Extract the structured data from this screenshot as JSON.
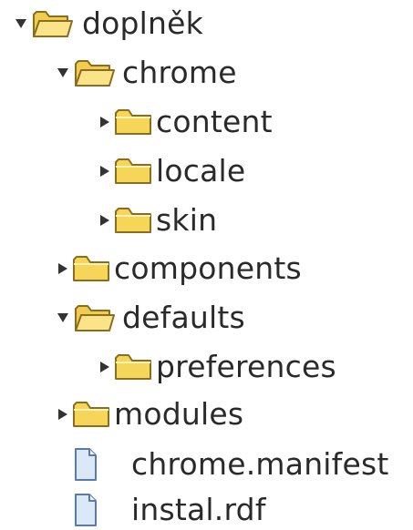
{
  "tree": {
    "root": {
      "label": "doplněk",
      "expanded": true,
      "icon": "folder-open-icon",
      "children": {
        "chrome": {
          "label": "chrome",
          "expanded": true,
          "icon": "folder-open-icon",
          "children": {
            "content": {
              "label": "content",
              "expanded": false,
              "icon": "folder-icon"
            },
            "locale": {
              "label": "locale",
              "expanded": false,
              "icon": "folder-icon"
            },
            "skin": {
              "label": "skin",
              "expanded": false,
              "icon": "folder-icon"
            }
          }
        },
        "components": {
          "label": "components",
          "expanded": false,
          "icon": "folder-icon"
        },
        "defaults": {
          "label": "defaults",
          "expanded": true,
          "icon": "folder-open-icon",
          "children": {
            "preferences": {
              "label": "preferences",
              "expanded": false,
              "icon": "folder-icon"
            }
          }
        },
        "modules": {
          "label": "modules",
          "expanded": false,
          "icon": "folder-icon"
        },
        "chrome_manifest": {
          "label": "chrome.manifest",
          "icon": "file-icon"
        },
        "instal_rdf": {
          "label": "instal.rdf",
          "icon": "file-icon"
        }
      }
    }
  },
  "colors": {
    "folder_fill": "#f7dc6f",
    "folder_stroke": "#8a6d1f",
    "folder_light": "#fdf2b8",
    "file_fill": "#dbe8f8",
    "file_stroke": "#5a7aa8",
    "arrow": "#333333",
    "text": "#2a2a2a"
  }
}
